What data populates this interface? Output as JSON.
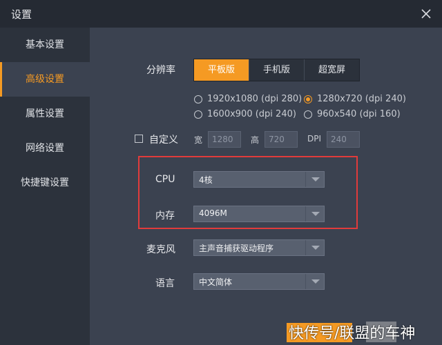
{
  "window": {
    "title": "设置"
  },
  "sidebar": {
    "items": [
      {
        "label": "基本设置"
      },
      {
        "label": "高级设置",
        "active": true
      },
      {
        "label": "属性设置"
      },
      {
        "label": "网络设置"
      },
      {
        "label": "快捷键设置"
      }
    ]
  },
  "resolution": {
    "label": "分辨率",
    "tabs": [
      "平板版",
      "手机版",
      "超宽屏"
    ],
    "active_tab": "平板版",
    "options": [
      "1920x1080 (dpi 280)",
      "1280x720 (dpi 240)",
      "1600x900 (dpi 240)",
      "960x540 (dpi 160)"
    ],
    "selected_option": "1280x720 (dpi 240)"
  },
  "custom": {
    "label": "自定义",
    "width_label": "宽",
    "width_value": "1280",
    "height_label": "高",
    "height_value": "720",
    "dpi_label": "DPI",
    "dpi_value": "240"
  },
  "cpu": {
    "label": "CPU",
    "value": "4核"
  },
  "memory": {
    "label": "内存",
    "value": "4096M"
  },
  "microphone": {
    "label": "麦克风",
    "value": "主声音捕获驱动程序"
  },
  "language": {
    "label": "语言",
    "value": "中文简体"
  },
  "watermark": {
    "text": "快传号/联盟的车神"
  },
  "colors": {
    "accent": "#f59a23",
    "highlight_border": "#e23b3b",
    "background": "#3b4250",
    "sidebar": "#2c323c"
  }
}
